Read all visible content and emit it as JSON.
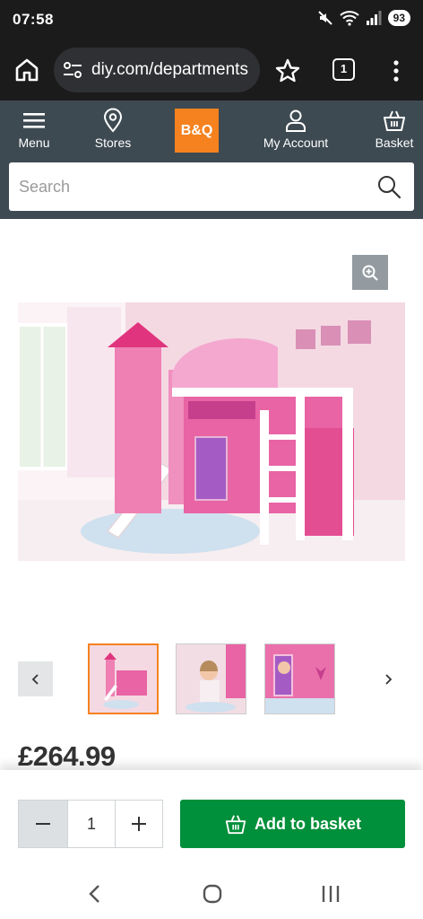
{
  "status": {
    "time": "07:58",
    "battery": "93"
  },
  "browser": {
    "url": "diy.com/departments",
    "tab_count": "1"
  },
  "site_nav": {
    "menu_label": "Menu",
    "stores_label": "Stores",
    "logo_text": "B&Q",
    "account_label": "My Account",
    "basket_label": "Basket"
  },
  "search": {
    "placeholder": "Search"
  },
  "product": {
    "price": "£264.99",
    "thumbnails": [
      "thumbnail-1",
      "thumbnail-2",
      "thumbnail-3"
    ],
    "active_thumbnail": 0
  },
  "basket_bar": {
    "quantity": "1",
    "add_label": "Add to basket"
  },
  "colors": {
    "brand_orange": "#f5821f",
    "nav_bg": "#3e4a52",
    "add_green": "#008f3a"
  },
  "icons": [
    "home-icon",
    "site-settings-icon",
    "star-icon",
    "more-icon",
    "menu-icon",
    "store-pin-icon",
    "account-icon",
    "basket-icon",
    "search-icon",
    "zoom-in-icon",
    "chevron-left-icon",
    "chevron-right-icon"
  ]
}
